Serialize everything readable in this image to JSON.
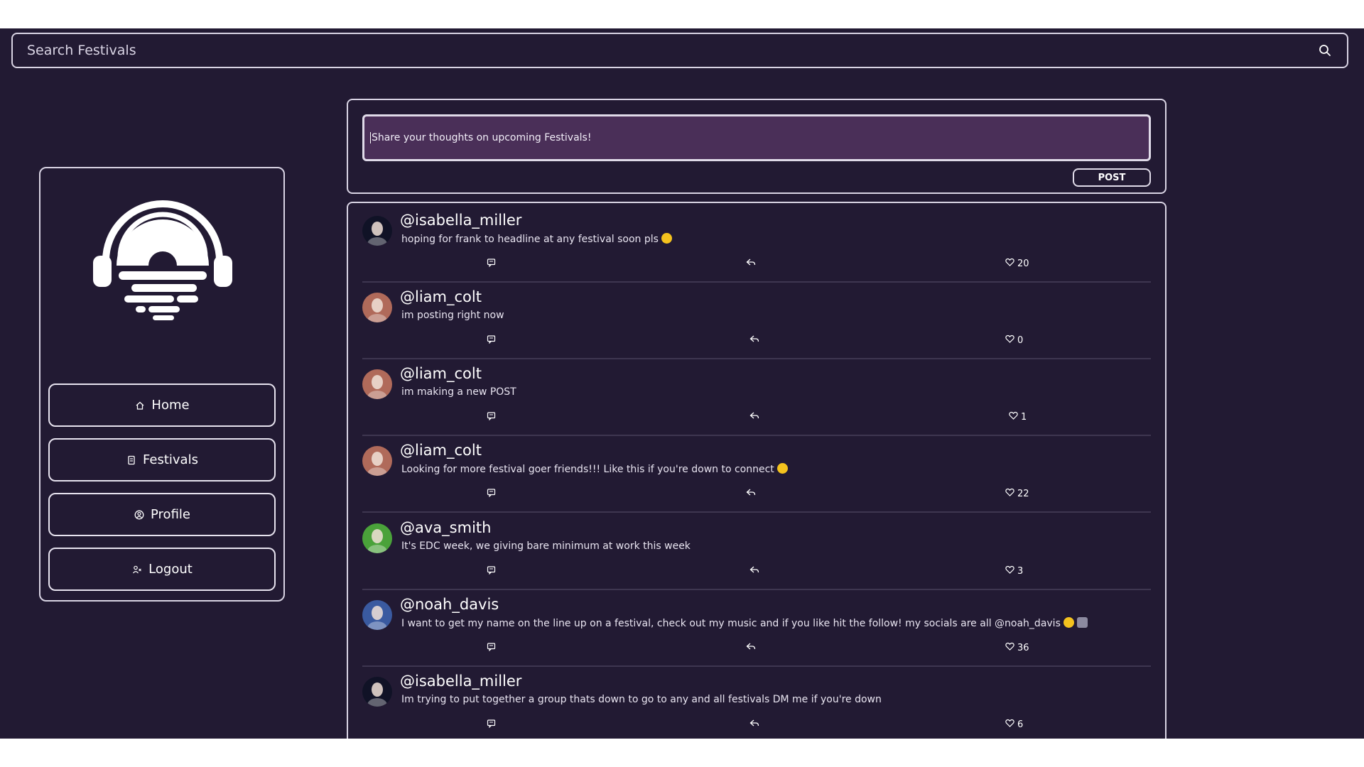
{
  "search": {
    "placeholder": "Search Festivals",
    "icon": "search-icon"
  },
  "sidebar": {
    "logo_icon": "headphones-sunset-logo",
    "nav": [
      {
        "label": "Home",
        "icon": "home-icon"
      },
      {
        "label": "Festivals",
        "icon": "festival-icon"
      },
      {
        "label": "Profile",
        "icon": "profile-icon"
      },
      {
        "label": "Logout",
        "icon": "logout-icon"
      }
    ]
  },
  "composer": {
    "placeholder": "Share your thoughts on upcoming Festivals!",
    "post_label": "POST"
  },
  "posts": [
    {
      "username": "@isabella_miller",
      "text": "hoping for frank to headline at any festival soon pls",
      "emoji": "smile",
      "likes": "20",
      "avatar_color": "#101226"
    },
    {
      "username": "@liam_colt",
      "text": "im posting right now",
      "emoji": "",
      "likes": "0",
      "avatar_color": "#b06a5a"
    },
    {
      "username": "@liam_colt",
      "text": "im making a new POST",
      "emoji": "",
      "likes": "1",
      "avatar_color": "#b06a5a"
    },
    {
      "username": "@liam_colt",
      "text": "Looking for more festival goer friends!!! Like this if you're down to connect",
      "emoji": "smile",
      "likes": "22",
      "avatar_color": "#b06a5a"
    },
    {
      "username": "@ava_smith",
      "text": "It's EDC week, we giving bare minimum at work this week",
      "emoji": "",
      "likes": "3",
      "avatar_color": "#4aa23a"
    },
    {
      "username": "@noah_davis",
      "text": "I want to get my name on the line up on a festival, check out my music and if you like hit the follow! my socials are all @noah_davis",
      "emoji": "smile-speaker",
      "likes": "36",
      "avatar_color": "#3a5aa0"
    },
    {
      "username": "@isabella_miller",
      "text": "Im trying to put together a group thats down to go to any and all festivals DM me if you're down",
      "emoji": "",
      "likes": "6",
      "avatar_color": "#101226"
    }
  ],
  "colors": {
    "background": "#221a33",
    "border": "#d9d4e4",
    "composer_fill": "#4a2f58",
    "text": "#ffffff"
  }
}
